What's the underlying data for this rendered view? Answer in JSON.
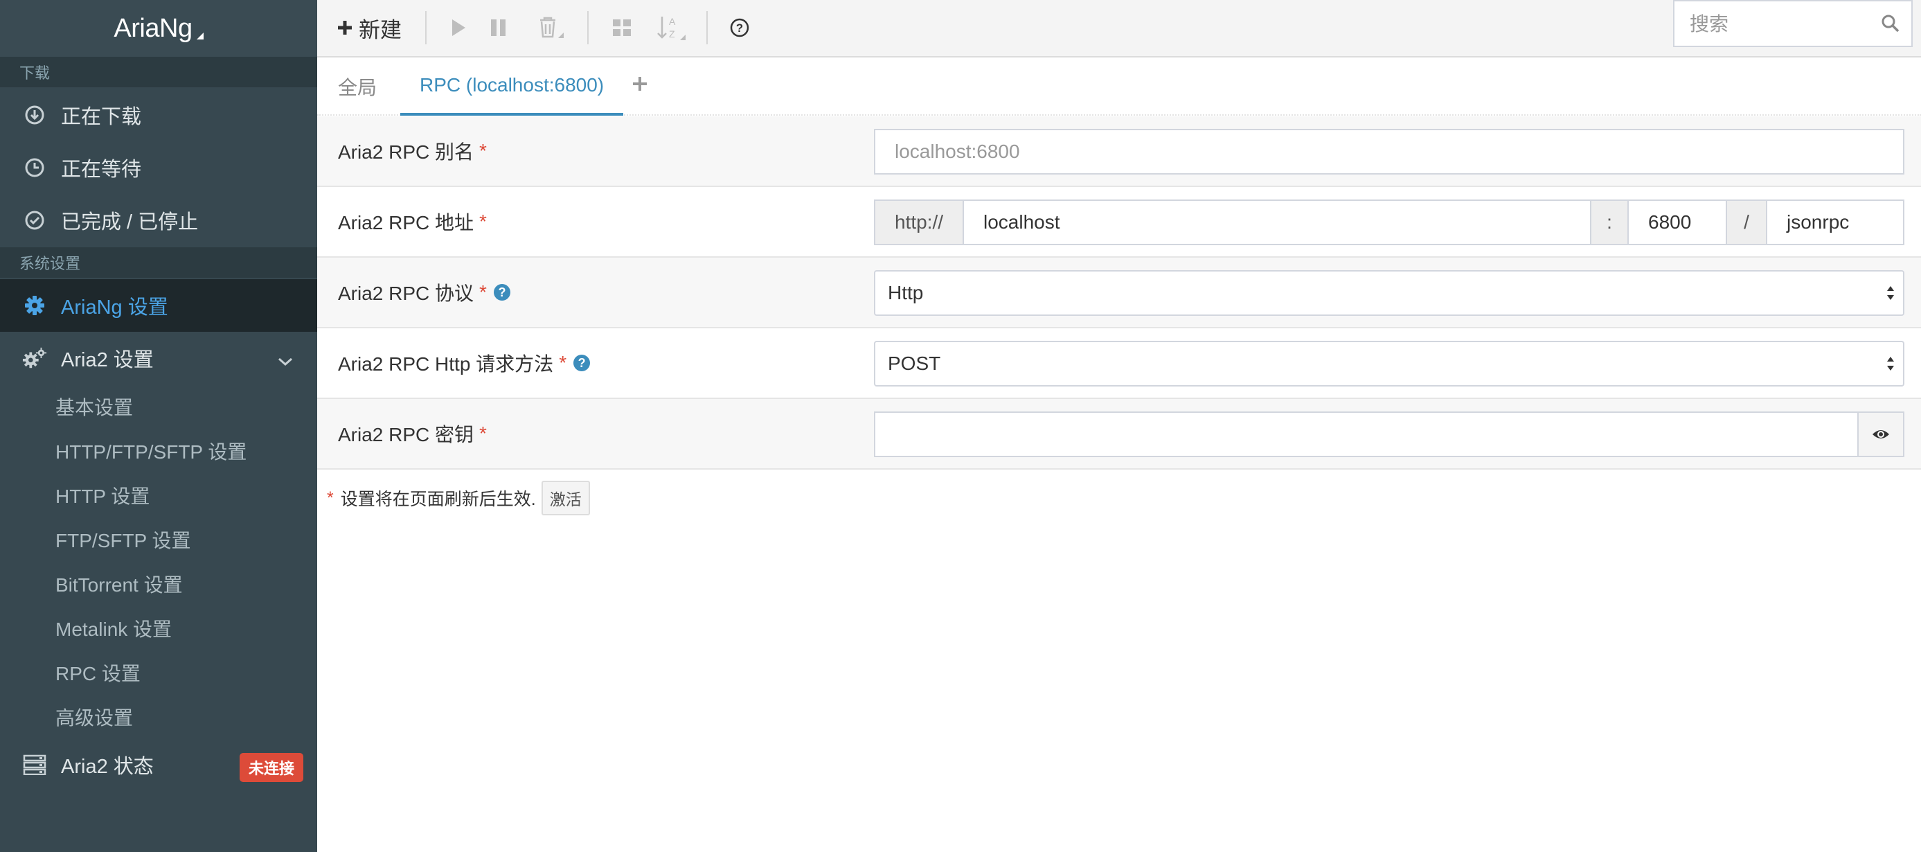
{
  "brand": {
    "name": "AriaNg"
  },
  "sidebar": {
    "section_download": "下载",
    "downloading": "正在下载",
    "waiting": "正在等待",
    "stopped": "已完成 / 已停止",
    "section_settings": "系统设置",
    "ariang_settings": "AriaNg 设置",
    "aria2_settings": "Aria2 设置",
    "sub_items": [
      "基本设置",
      "HTTP/FTP/SFTP 设置",
      "HTTP 设置",
      "FTP/SFTP 设置",
      "BitTorrent 设置",
      "Metalink 设置",
      "RPC 设置",
      "高级设置"
    ],
    "aria2_status": "Aria2 状态",
    "status_badge": "未连接",
    "accent_color": "#4ba4e6",
    "badge_color": "#dd4b39"
  },
  "toolbar": {
    "new_label": "新建",
    "search_placeholder": "搜索",
    "icons": [
      "plus-icon",
      "play-icon",
      "pause-icon",
      "trash-icon",
      "grid-icon",
      "sort-az-icon",
      "help-circle-icon",
      "search-icon"
    ]
  },
  "tabs": {
    "global": "全局",
    "rpc": "RPC (localhost:6800)",
    "add_icon": "plus-icon"
  },
  "form": {
    "alias_label": "Aria2 RPC 别名",
    "alias_placeholder": "localhost:6800",
    "address_label": "Aria2 RPC 地址",
    "address_protocol": "http://",
    "address_host": "localhost",
    "address_colon": ":",
    "address_port": "6800",
    "address_slash": "/",
    "address_path": "jsonrpc",
    "protocol_label": "Aria2 RPC 协议",
    "protocol_value": "Http",
    "method_label": "Aria2 RPC Http 请求方法",
    "method_value": "POST",
    "secret_label": "Aria2 RPC 密钥",
    "secret_value": "",
    "required_mark": "*",
    "help_mark": "?"
  },
  "note": {
    "text": "设置将在页面刷新后生效.",
    "activate_label": "激活"
  }
}
